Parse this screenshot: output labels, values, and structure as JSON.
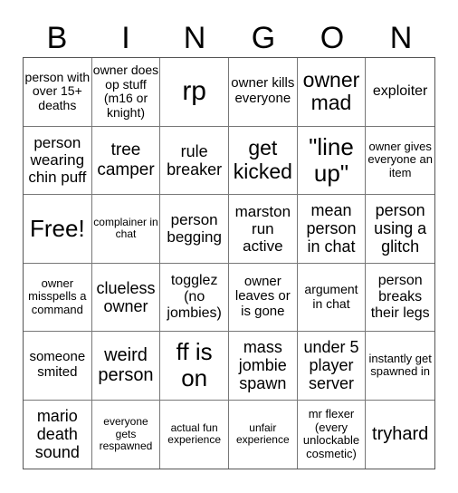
{
  "header": [
    "B",
    "I",
    "N",
    "G",
    "O",
    "N"
  ],
  "cells": [
    "person with over 15+ deaths",
    "owner does op stuff (m16 or knight)",
    "rp",
    "owner kills everyone",
    "owner mad",
    "exploiter",
    "person wearing chin puff",
    "tree camper",
    "rule breaker",
    "get kicked",
    "\"line up\"",
    "owner gives everyone an item",
    "Free!",
    "complainer in chat",
    "person begging",
    "marston run active",
    "mean person in chat",
    "person using a glitch",
    "owner misspells a command",
    "clueless owner",
    "togglez (no jombies)",
    "owner leaves or is gone",
    "argument in chat",
    "person breaks their legs",
    "someone smited",
    "weird person",
    "ff is on",
    "mass jombie spawn",
    "under 5 player server",
    "instantly get spawned in",
    "mario death sound",
    "everyone gets respawned",
    "actual fun experience",
    "unfair experience",
    "mr flexer (every unlockable cosmetic)",
    "tryhard"
  ]
}
